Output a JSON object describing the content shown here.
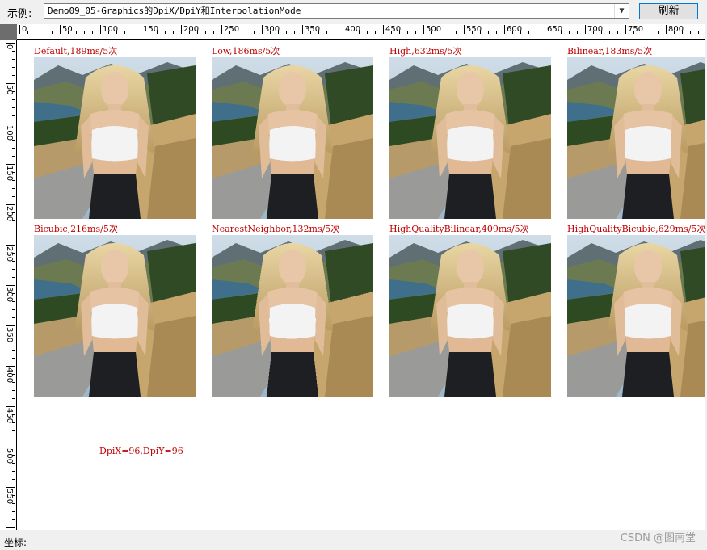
{
  "toolbar": {
    "example_label": "示例:",
    "example_value": "Demo09_05-Graphics的DpiX/DpiY和InterpolationMode",
    "refresh_label": "刷新"
  },
  "ruler": {
    "h_labels": [
      "0",
      "50",
      "100",
      "150",
      "200",
      "250",
      "300",
      "350",
      "400",
      "450",
      "500",
      "550",
      "600",
      "650",
      "700",
      "750",
      "800"
    ],
    "v_labels": [
      "0",
      "50",
      "100",
      "150",
      "200",
      "250",
      "300",
      "350",
      "400",
      "450",
      "500",
      "550"
    ]
  },
  "images": [
    {
      "label": "Default,189ms/5次",
      "mode": "smooth"
    },
    {
      "label": "Low,186ms/5次",
      "mode": "smooth"
    },
    {
      "label": "High,632ms/5次",
      "mode": "smooth"
    },
    {
      "label": "Bilinear,183ms/5次",
      "mode": "smooth"
    },
    {
      "label": "Bicubic,216ms/5次",
      "mode": "smooth"
    },
    {
      "label": "NearestNeighbor,132ms/5次",
      "mode": "jagged"
    },
    {
      "label": "HighQualityBilinear,409ms/5次",
      "mode": "smooth"
    },
    {
      "label": "HighQualityBicubic,629ms/5次",
      "mode": "smooth"
    }
  ],
  "dpi_text": "DpiX=96,DpiY=96",
  "status": {
    "coord_label": "坐标:",
    "watermark": "CSDN @图南堂"
  },
  "colors": {
    "label_red": "#c00000",
    "button_border": "#0078d7"
  }
}
